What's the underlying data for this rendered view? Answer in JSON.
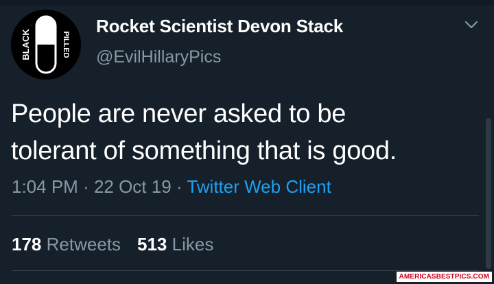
{
  "tweet": {
    "display_name": "Rocket Scientist Devon Stack",
    "handle": "@EvilHillaryPics",
    "avatar": {
      "left_text": "BLACK",
      "right_text": "PILLED"
    },
    "text_lines": [
      "People are never asked to be",
      "tolerant of something that is good."
    ],
    "time": "1:04 PM",
    "date": "22 Oct 19",
    "source": "Twitter Web Client",
    "separator": " · ",
    "retweets_count": "178",
    "retweets_label": "Retweets",
    "likes_count": "513",
    "likes_label": "Likes",
    "menu_icon": "chevron-down-icon"
  },
  "watermark": "AMERICASBESTPICS.COM",
  "colors": {
    "background": "#15202b",
    "text": "#ffffff",
    "secondary": "#8899a6",
    "link": "#1da1f2",
    "divider": "#38444d"
  }
}
